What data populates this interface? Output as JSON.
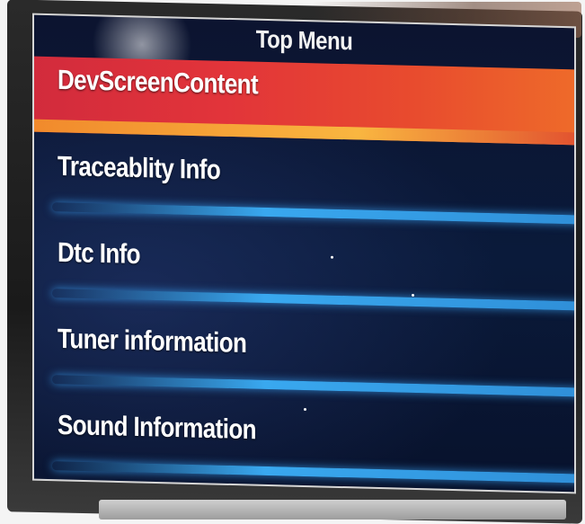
{
  "screen": {
    "title": "Top Menu"
  },
  "menu": {
    "items": [
      {
        "label": "DevScreenContent",
        "selected": true
      },
      {
        "label": "Traceablity Info",
        "selected": false
      },
      {
        "label": "Dtc Info",
        "selected": false
      },
      {
        "label": "Tuner information",
        "selected": false
      },
      {
        "label": "Sound Information",
        "selected": false
      }
    ]
  },
  "colors": {
    "selected_bg": "#e2343a",
    "separator": "#39a8ef",
    "screen_bg": "#0a1a3a",
    "text": "#ffffff"
  }
}
